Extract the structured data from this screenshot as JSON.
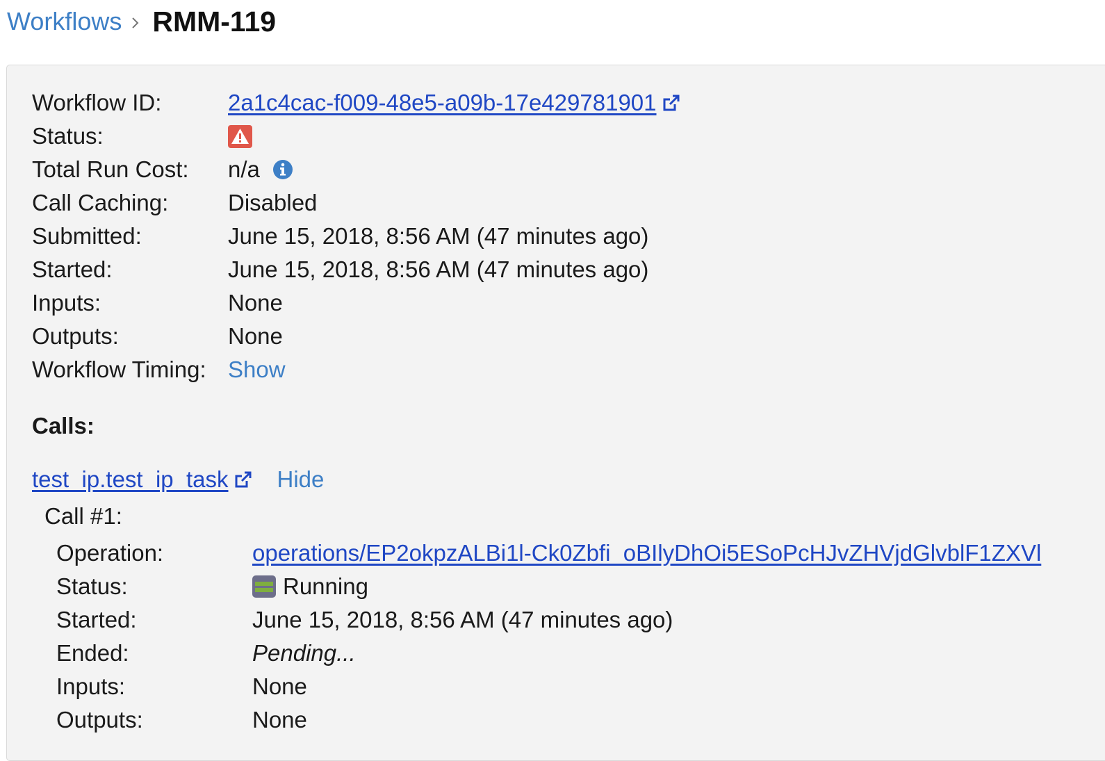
{
  "breadcrumb": {
    "parent": "Workflows",
    "current": "RMM-119"
  },
  "workflow": {
    "id_label": "Workflow ID:",
    "id_value": "2a1c4cac-f009-48e5-a09b-17e429781901",
    "status_label": "Status:",
    "status_icon": "warning-icon",
    "cost_label": "Total Run Cost:",
    "cost_value": "n/a",
    "caching_label": "Call Caching:",
    "caching_value": "Disabled",
    "submitted_label": "Submitted:",
    "submitted_value": "June 15, 2018, 8:56 AM (47 minutes ago)",
    "started_label": "Started:",
    "started_value": "June 15, 2018, 8:56 AM (47 minutes ago)",
    "inputs_label": "Inputs:",
    "inputs_value": "None",
    "outputs_label": "Outputs:",
    "outputs_value": "None",
    "timing_label": "Workflow Timing:",
    "timing_action": "Show"
  },
  "calls": {
    "title": "Calls:",
    "task_name": "test_ip.test_ip_task",
    "hide_label": "Hide",
    "call_number": "Call #1:",
    "operation_label": "Operation:",
    "operation_value": "operations/EP2okpzALBi1l-Ck0Zbfi_oBIlyDhOi5ESoPcHJvZHVjdGlvblF1ZXVl",
    "status_label": "Status:",
    "status_value": "Running",
    "started_label": "Started:",
    "started_value": "June 15, 2018, 8:56 AM (47 minutes ago)",
    "ended_label": "Ended:",
    "ended_value": "Pending...",
    "inputs_label": "Inputs:",
    "inputs_value": "None",
    "outputs_label": "Outputs:",
    "outputs_value": "None"
  },
  "colors": {
    "link": "#1f47c4",
    "light_link": "#3d7fc6",
    "failed": "#e0574a",
    "running_bg": "#6d6e8a",
    "running_bar": "#7fae3f",
    "panel_bg": "#f3f3f3"
  }
}
